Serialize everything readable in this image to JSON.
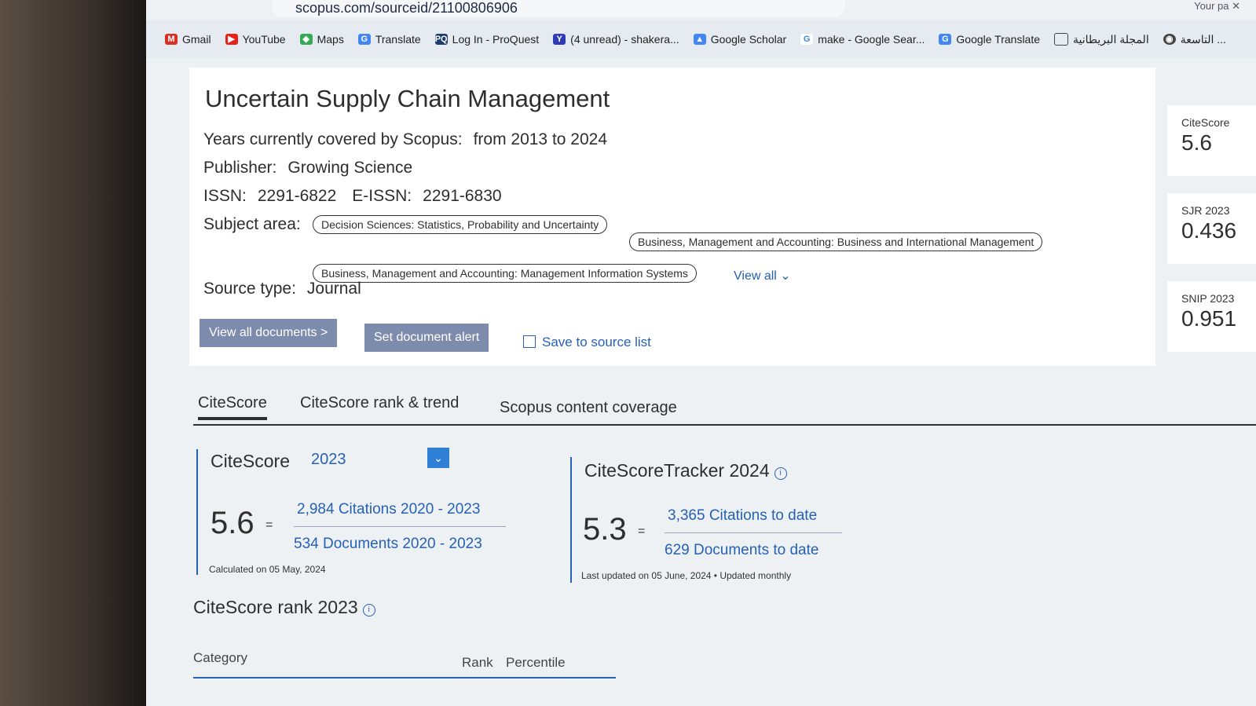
{
  "browser": {
    "url": "scopus.com/sourceid/21100806906",
    "topright": "Your pa",
    "bookmarks": [
      {
        "label": "Gmail",
        "icon": "gmail-icon"
      },
      {
        "label": "YouTube",
        "icon": "youtube-icon"
      },
      {
        "label": "Maps",
        "icon": "maps-icon"
      },
      {
        "label": "Translate",
        "icon": "translate-icon"
      },
      {
        "label": "Log In - ProQuest",
        "icon": "proquest-icon"
      },
      {
        "label": "(4 unread) - shakera...",
        "icon": "yahoo-icon"
      },
      {
        "label": "Google Scholar",
        "icon": "scholar-icon"
      },
      {
        "label": "make - Google Sear...",
        "icon": "google-icon"
      },
      {
        "label": "Google Translate",
        "icon": "translate-icon"
      },
      {
        "label": "المجلة البريطانية",
        "icon": "folder-icon"
      },
      {
        "label": "التاسعة ...",
        "icon": "globe-icon"
      }
    ]
  },
  "source": {
    "title": "Uncertain Supply Chain Management",
    "years_label": "Years currently covered by Scopus:",
    "years_value": "from 2013 to 2024",
    "publisher_label": "Publisher:",
    "publisher_value": "Growing Science",
    "issn_label": "ISSN:",
    "issn_value": "2291-6822",
    "eissn_label": "E-ISSN:",
    "eissn_value": "2291-6830",
    "subject_label": "Subject area:",
    "subjects": [
      "Decision Sciences: Statistics, Probability and Uncertainty",
      "Business, Management and Accounting: Business and International Management",
      "Business, Management and Accounting: Management Information Systems"
    ],
    "view_all": "View all",
    "source_type_label": "Source type:",
    "source_type_value": "Journal"
  },
  "actions": {
    "view_all_documents": "View all documents >",
    "set_document_alert": "Set document alert",
    "save_to_source_list": "Save to source list"
  },
  "metrics": [
    {
      "label": "CiteScore",
      "value": "5.6"
    },
    {
      "label": "SJR 2023",
      "value": "0.436"
    },
    {
      "label": "SNIP 2023",
      "value": "0.951"
    }
  ],
  "tabs": [
    "CiteScore",
    "CiteScore rank & trend",
    "Scopus content coverage"
  ],
  "citescore": {
    "title": "CiteScore",
    "year": "2023",
    "value": "5.6",
    "equals": "=",
    "numerator": "2,984 Citations 2020 - 2023",
    "denominator": "534 Documents 2020 - 2023",
    "calculated": "Calculated on 05 May, 2024"
  },
  "tracker": {
    "title": "CiteScoreTracker 2024",
    "value": "5.3",
    "equals": "=",
    "numerator": "3,365 Citations to date",
    "denominator": "629 Documents to date",
    "updated": "Last updated on 05 June, 2024 • Updated monthly"
  },
  "rank": {
    "title": "CiteScore rank 2023",
    "columns": [
      "Category",
      "Rank",
      "Percentile"
    ]
  }
}
